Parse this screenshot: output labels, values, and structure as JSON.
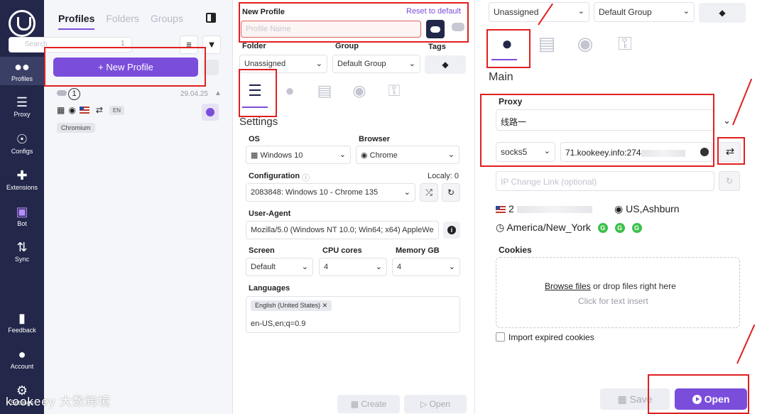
{
  "nav": {
    "items": [
      {
        "label": "Profiles",
        "icon": "users-icon"
      },
      {
        "label": "Proxy",
        "icon": "server-icon"
      },
      {
        "label": "Configs",
        "icon": "fingerprint-icon"
      },
      {
        "label": "Extensions",
        "icon": "puzzle-icon"
      },
      {
        "label": "Bot",
        "icon": "lock-icon"
      },
      {
        "label": "Sync",
        "icon": "sync-icon"
      },
      {
        "label": "Feedback",
        "icon": "feedback-icon"
      },
      {
        "label": "Account",
        "icon": "account-icon"
      },
      {
        "label": "Settings",
        "icon": "gear-icon"
      }
    ]
  },
  "profiles_panel": {
    "tabs": [
      "Profiles",
      "Folders",
      "Groups"
    ],
    "search_placeholder": "Search",
    "search_count": "1",
    "new_profile_label": "New Profile",
    "profile": {
      "number": "1",
      "date": "29.04.25",
      "lang": "EN",
      "browser_chip": "Chromium"
    }
  },
  "form": {
    "new_profile_label": "New Profile",
    "reset_label": "Reset to default",
    "name_placeholder": "Profile Name",
    "folder_label": "Folder",
    "folder_value": "Unassigned",
    "group_label": "Group",
    "group_value": "Default Group",
    "tags_label": "Tags",
    "settings_title": "Settings",
    "os_label": "OS",
    "os_value": "Windows 10",
    "browser_label": "Browser",
    "browser_value": "Chrome",
    "configuration_label": "Configuration",
    "localy_label": "Localy: 0",
    "configuration_value": "2083848: Windows 10 - Chrome 135",
    "user_agent_label": "User-Agent",
    "user_agent_value": "Mozilla/5.0 (Windows NT 10.0; Win64; x64) AppleWe",
    "screen_label": "Screen",
    "screen_value": "Default",
    "cpu_label": "CPU cores",
    "cpu_value": "4",
    "memory_label": "Memory GB",
    "memory_value": "4",
    "languages_label": "Languages",
    "language_chip": "English (United States)",
    "language_value": "en-US,en;q=0.9",
    "create_label": "Create",
    "open_label": "Open"
  },
  "right": {
    "folder_value": "Unassigned",
    "group_value": "Default Group",
    "main_title": "Main",
    "proxy_label": "Proxy",
    "proxy_value": "线路一",
    "protocol_value": "socks5",
    "host_value": "71.kookeey.info:274",
    "ip_change_placeholder": "IP Change Link (optional)",
    "ip_prefix": "2",
    "location": "US,Ashburn",
    "timezone": "America/New_York",
    "status_icons": [
      "G",
      "G",
      "G"
    ],
    "cookies_label": "Cookies",
    "browse_files": "Browse files",
    "drop_hint": "or drop files right here",
    "click_hint": "Click for text insert",
    "import_expired": "Import expired cookies",
    "save_label": "Save",
    "open_label": "Open"
  },
  "watermark": "kookeey 大数跨境",
  "colors": {
    "accent": "#7b4ddb",
    "rail": "#23274a",
    "annotation": "#e02020"
  }
}
